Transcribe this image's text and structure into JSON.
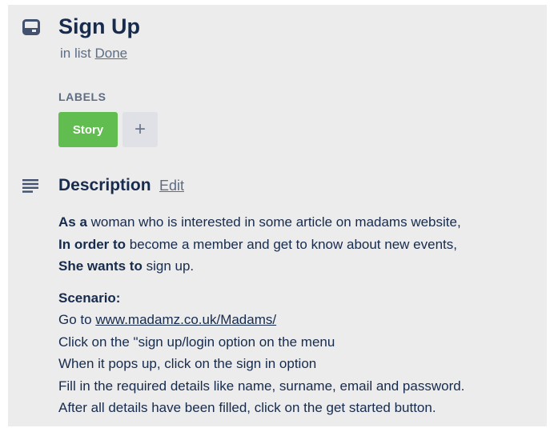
{
  "card": {
    "icon": "card-icon",
    "title": "Sign Up",
    "list_prefix": "in list",
    "list_name": "Done"
  },
  "labels": {
    "heading": "LABELS",
    "items": [
      {
        "text": "Story",
        "color": "#61bd4f"
      }
    ],
    "add_icon": "plus-icon",
    "add_symbol": "+"
  },
  "description": {
    "icon": "description-lines-icon",
    "title": "Description",
    "edit_label": "Edit",
    "story": {
      "as_a_bold": "As a",
      "as_a_text": " woman who is interested in some article on madams website,",
      "in_order_bold": "In order to",
      "in_order_text": " become a member and get to know about new events,",
      "she_wants_bold": "She wants to",
      "she_wants_text": " sign up."
    },
    "scenario": {
      "heading": "Scenario:",
      "goto_prefix": "Go to ",
      "goto_link": "www.madamz.co.uk/Madams/",
      "steps": [
        "Click on the \"sign up/login option on the menu",
        "When it pops up, click on the sign in option",
        "Fill in the required details like name, surname, email and password.",
        "After all details have been filled, click on the get started button."
      ]
    }
  },
  "colors": {
    "card_background": "#ececec",
    "title_text": "#172b4d",
    "muted_text": "#5e6c84",
    "label_green": "#61bd4f",
    "add_button_bg": "#dfe1e6"
  }
}
